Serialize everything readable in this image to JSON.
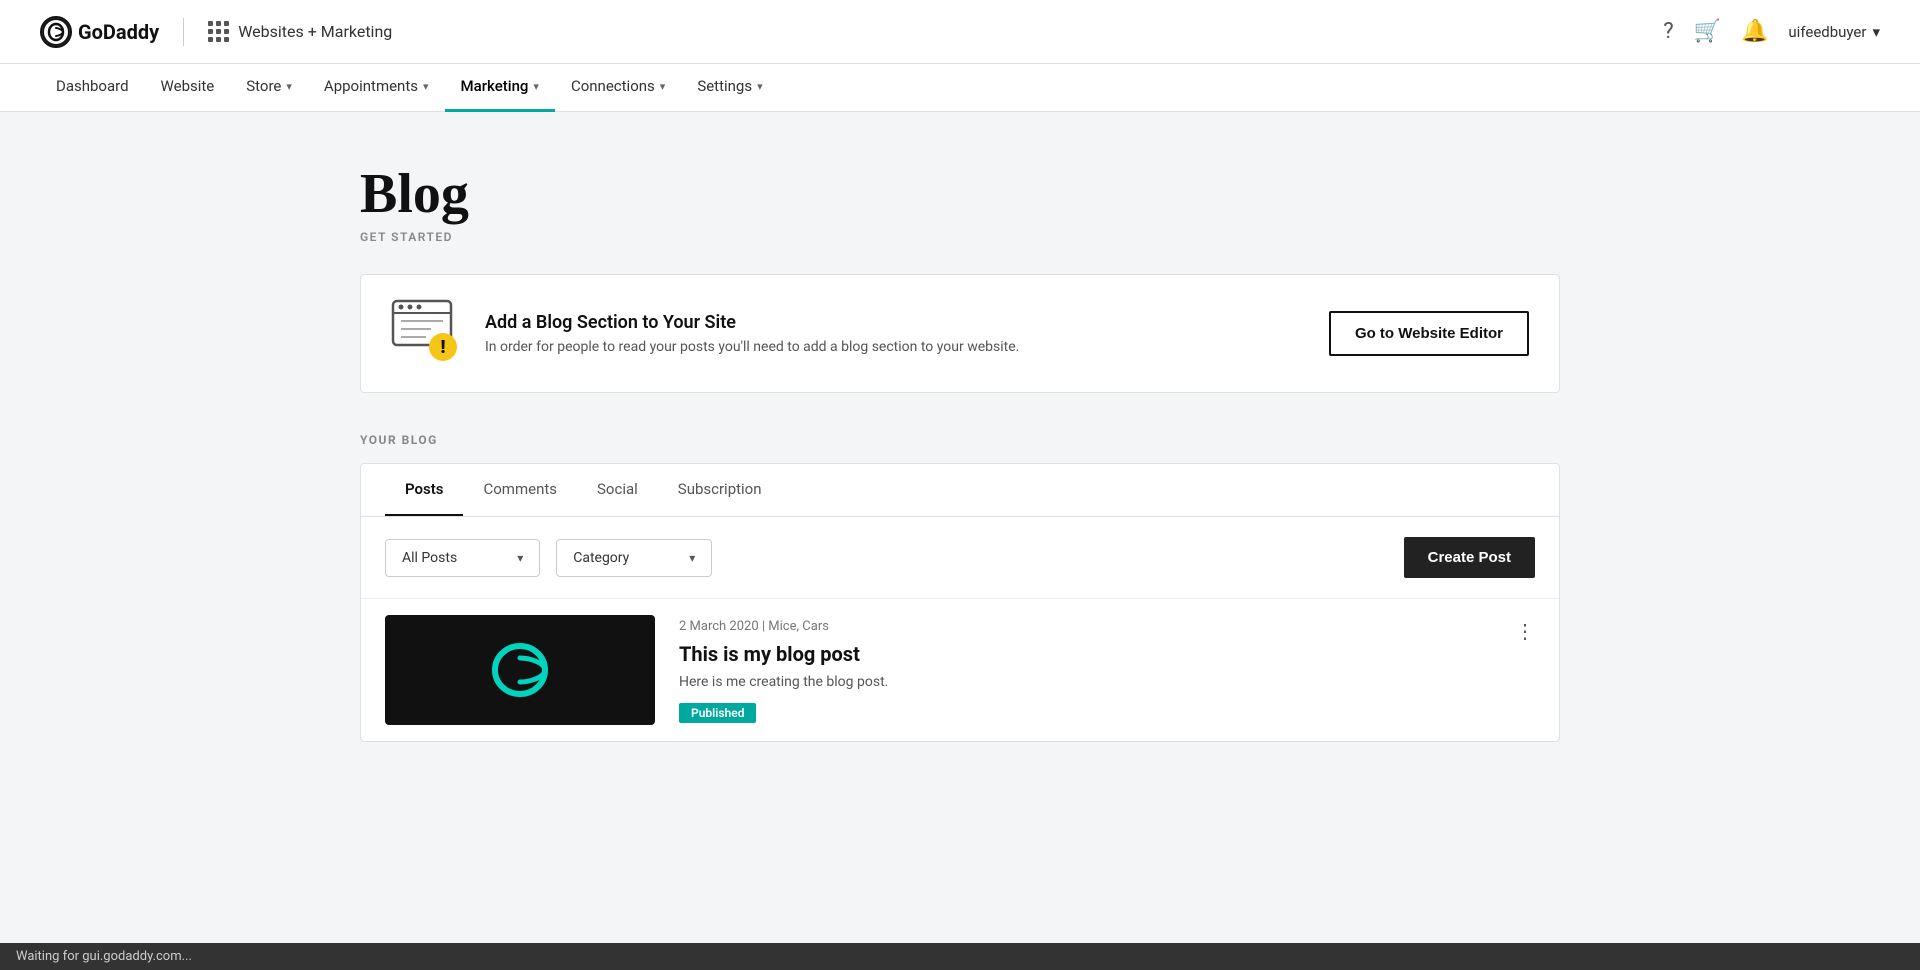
{
  "header": {
    "logo_circle": "G",
    "brand_name": "GoDaddy",
    "divider": "|",
    "app_name": "Websites + Marketing",
    "icons": {
      "help": "?",
      "cart": "🛒",
      "bell": "🔔"
    },
    "user": "uifeedbuyer",
    "user_chevron": "▾"
  },
  "nav": {
    "items": [
      {
        "label": "Dashboard",
        "active": false,
        "has_chevron": false
      },
      {
        "label": "Website",
        "active": false,
        "has_chevron": false
      },
      {
        "label": "Store",
        "active": false,
        "has_chevron": true
      },
      {
        "label": "Appointments",
        "active": false,
        "has_chevron": true
      },
      {
        "label": "Marketing",
        "active": true,
        "has_chevron": true
      },
      {
        "label": "Connections",
        "active": false,
        "has_chevron": true
      },
      {
        "label": "Settings",
        "active": false,
        "has_chevron": true
      }
    ]
  },
  "page": {
    "title": "Blog",
    "subtitle": "GET STARTED"
  },
  "alert": {
    "heading": "Add a Blog Section to Your Site",
    "description": "In order for people to read your posts you'll need to add a blog section to your website.",
    "button_label": "Go to Website Editor"
  },
  "blog_section": {
    "label": "YOUR BLOG",
    "tabs": [
      {
        "label": "Posts",
        "active": true
      },
      {
        "label": "Comments",
        "active": false
      },
      {
        "label": "Social",
        "active": false
      },
      {
        "label": "Subscription",
        "active": false
      }
    ],
    "filters": {
      "posts_filter": "All Posts",
      "category_filter": "Category"
    },
    "create_button": "Create Post",
    "posts": [
      {
        "date": "2 March 2020",
        "categories": "Mice, Cars",
        "title": "This is my blog post",
        "excerpt": "Here is me creating the blog post.",
        "status": "Published"
      }
    ]
  },
  "status_bar": {
    "text": "Waiting for gui.godaddy.com..."
  }
}
